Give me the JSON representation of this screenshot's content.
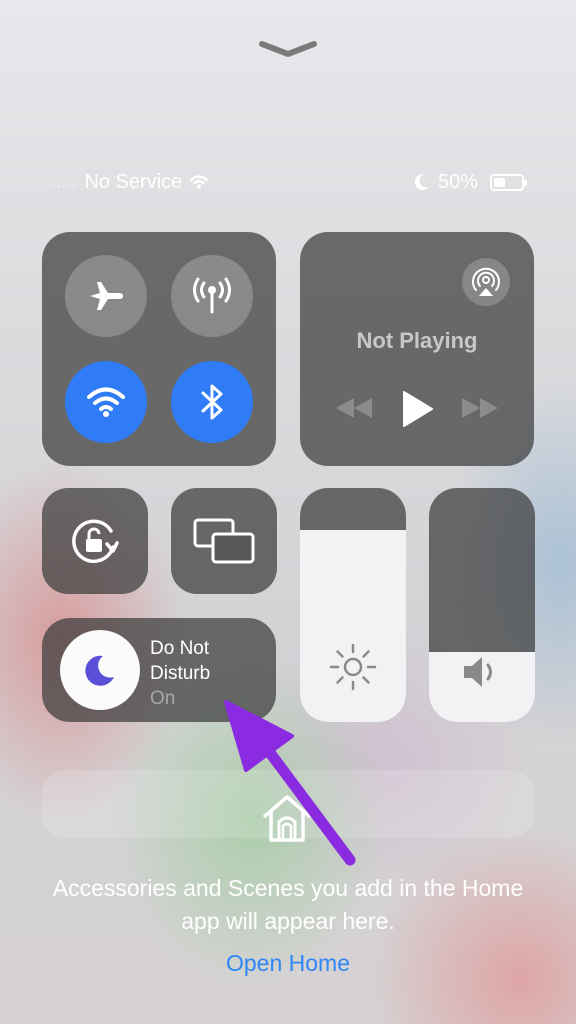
{
  "status_bar": {
    "signal": ".....",
    "carrier": "No Service",
    "battery_percent": "50%",
    "battery_level": 0.5,
    "icons": [
      "wifi-icon",
      "moon-icon",
      "battery-icon"
    ]
  },
  "connectivity": {
    "airplane_mode": {
      "icon": "airplane-icon",
      "active": false
    },
    "cellular": {
      "icon": "antenna-icon",
      "active": false
    },
    "wifi": {
      "icon": "wifi-icon",
      "active": true
    },
    "bluetooth": {
      "icon": "bluetooth-icon",
      "active": true
    }
  },
  "media": {
    "title": "Not Playing",
    "controls": [
      "rewind-icon",
      "play-icon",
      "fast-forward-icon"
    ],
    "airplay_icon": "airplay-icon"
  },
  "rotation_lock": {
    "icon": "rotation-lock-icon"
  },
  "screen_mirroring": {
    "icon": "screen-mirroring-icon"
  },
  "do_not_disturb": {
    "line1": "Do Not",
    "line2": "Disturb",
    "state": "On",
    "icon": "moon-icon"
  },
  "brightness": {
    "level": 0.82,
    "icon": "sun-icon"
  },
  "volume": {
    "level": 0.3,
    "icon": "speaker-icon"
  },
  "home": {
    "icon": "home-icon",
    "description": "Accessories and Scenes you add in the Home app will appear here.",
    "link": "Open Home"
  },
  "colors": {
    "accent": "#2f7cf6",
    "annotation_arrow": "#8a2be2",
    "link": "#2f86f5"
  }
}
